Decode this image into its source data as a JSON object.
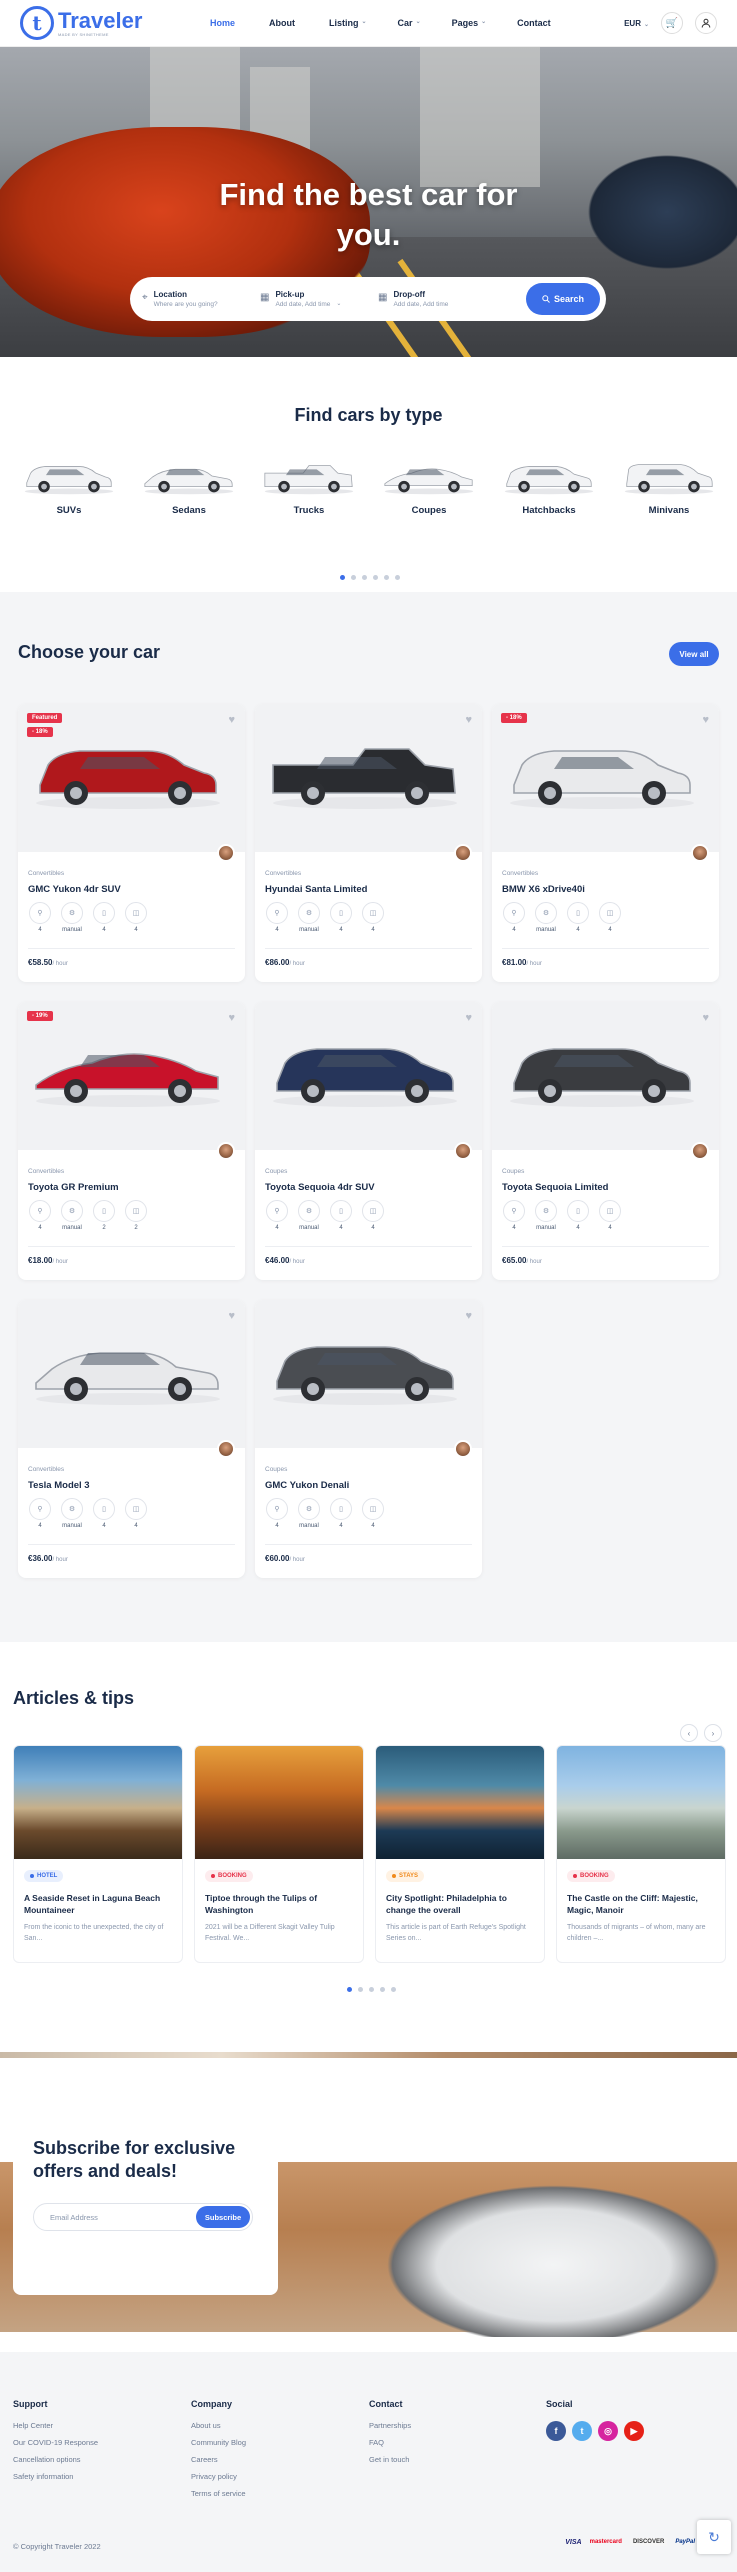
{
  "header": {
    "logo_name": "Traveler",
    "logo_tagline": "MADE BY SHINETHEME",
    "logo_letter": "t",
    "nav": [
      {
        "label": "Home",
        "active": true,
        "dropdown": false
      },
      {
        "label": "About",
        "active": false,
        "dropdown": false
      },
      {
        "label": "Listing",
        "active": false,
        "dropdown": true
      },
      {
        "label": "Car",
        "active": false,
        "dropdown": true
      },
      {
        "label": "Pages",
        "active": false,
        "dropdown": true
      },
      {
        "label": "Contact",
        "active": false,
        "dropdown": false
      }
    ],
    "currency": "EUR",
    "cart_icon": "cart-icon",
    "user_icon": "user-icon"
  },
  "hero": {
    "title_line1": "Find the best car for",
    "title_line2": "you.",
    "search": {
      "location_label": "Location",
      "location_placeholder": "Where are you going?",
      "pickup_label": "Pick-up",
      "pickup_placeholder": "Add date, Add time",
      "dropoff_label": "Drop-off",
      "dropoff_placeholder": "Add date, Add time",
      "button": "Search"
    }
  },
  "types": {
    "title": "Find cars by type",
    "items": [
      "SUVs",
      "Sedans",
      "Trucks",
      "Coupes",
      "Hatchbacks",
      "Minivans"
    ],
    "active_dot": 0,
    "dot_count": 6
  },
  "choose": {
    "title": "Choose your car",
    "view_all": "View all",
    "price_unit": "/ hour",
    "cars": [
      {
        "name": "GMC Yukon 4dr SUV",
        "category": "Convertibles",
        "price": "€58.50",
        "badges": [
          "Featured",
          "- 18%"
        ],
        "specs": [
          "4",
          "manual",
          "4",
          "4"
        ],
        "color": "#b0181c"
      },
      {
        "name": "Hyundai Santa Limited",
        "category": "Convertibles",
        "price": "€86.00",
        "badges": [],
        "specs": [
          "4",
          "manual",
          "4",
          "4"
        ],
        "color": "#2a2c30"
      },
      {
        "name": "BMW X6 xDrive40i",
        "category": "Convertibles",
        "price": "€81.00",
        "badges": [
          "- 18%"
        ],
        "specs": [
          "4",
          "manual",
          "4",
          "4"
        ],
        "color": "#e9eaec"
      },
      {
        "name": "Toyota GR Premium",
        "category": "Convertibles",
        "price": "€18.00",
        "badges": [
          "- 19%"
        ],
        "specs": [
          "4",
          "manual",
          "2",
          "2"
        ],
        "color": "#c8122a"
      },
      {
        "name": "Toyota Sequoia 4dr SUV",
        "category": "Coupes",
        "price": "€46.00",
        "badges": [],
        "specs": [
          "4",
          "manual",
          "4",
          "4"
        ],
        "color": "#26355a"
      },
      {
        "name": "Toyota Sequoia Limited",
        "category": "Coupes",
        "price": "€65.00",
        "badges": [],
        "specs": [
          "4",
          "manual",
          "4",
          "4"
        ],
        "color": "#3a3c40"
      },
      {
        "name": "Tesla Model 3",
        "category": "Convertibles",
        "price": "€36.00",
        "badges": [],
        "specs": [
          "4",
          "manual",
          "4",
          "4"
        ],
        "color": "#e8e9eb"
      },
      {
        "name": "GMC Yukon Denali",
        "category": "Coupes",
        "price": "€60.00",
        "badges": [],
        "specs": [
          "4",
          "manual",
          "4",
          "4"
        ],
        "color": "#4a4d52"
      }
    ]
  },
  "articles": {
    "title": "Articles & tips",
    "items": [
      {
        "tag": "HOTEL",
        "tag_color": "#3b6ee8",
        "tag_bg": "#e8effd",
        "title": "A Seaside Reset in Laguna Beach Mountaineer",
        "excerpt": "From the iconic to the unexpected, the city of San...",
        "img": "linear-gradient(180deg,#3f7fb8 0%,#7fb0d6 30%,#c7b08a 55%,#6b4a2c 75%,#3a2a1a 100%)"
      },
      {
        "tag": "BOOKING",
        "tag_color": "#e6334a",
        "tag_bg": "#fdecee",
        "title": "Tiptoe through the Tulips of Washington",
        "excerpt": "2021 will be a Different Skagit Valley Tulip Festival. We...",
        "img": "linear-gradient(180deg,#e7a03c 0%,#c56a22 40%,#7a3e1a 70%,#3b2416 100%)"
      },
      {
        "tag": "STAYS",
        "tag_color": "#f08a1c",
        "tag_bg": "#fff2e3",
        "title": "City Spotlight: Philadelphia to change the overall",
        "excerpt": "This article is part of Earth Refuge's Spotlight Series on...",
        "img": "linear-gradient(180deg,#2b5c7a 0%,#4f8aa8 35%,#d9874a 55%,#1d3a55 75%,#0f2233 100%)"
      },
      {
        "tag": "BOOKING",
        "tag_color": "#e6334a",
        "tag_bg": "#fdecee",
        "title": "The Castle on the Cliff: Majestic, Magic, Manoir",
        "excerpt": "Thousands of migrants – of whom, many are children –...",
        "img": "linear-gradient(180deg,#7fb3e0 0%,#a9cdeb 35%,#c9d5cf 55%,#8a9a8c 75%,#5e6b64 100%)"
      }
    ],
    "active_dot": 0,
    "dot_count": 5
  },
  "subscribe": {
    "title": "Subscribe for exclusive offers and deals!",
    "placeholder": "Email Address",
    "button": "Subscribe"
  },
  "footer": {
    "columns": [
      {
        "head": "Support",
        "links": [
          "Help Center",
          "Our COVID-19 Response",
          "Cancellation options",
          "Safety information"
        ]
      },
      {
        "head": "Company",
        "links": [
          "About us",
          "Community Blog",
          "Careers",
          "Privacy policy",
          "Terms of service"
        ]
      },
      {
        "head": "Contact",
        "links": [
          "Partnerships",
          "FAQ",
          "Get in touch"
        ]
      }
    ],
    "social_head": "Social",
    "socials": [
      {
        "icon": "facebook-icon",
        "glyph": "f",
        "color": "#3b5998"
      },
      {
        "icon": "twitter-icon",
        "glyph": "t",
        "color": "#55acee"
      },
      {
        "icon": "instagram-icon",
        "glyph": "◎",
        "color": "#d6249f"
      },
      {
        "icon": "youtube-icon",
        "glyph": "▶",
        "color": "#e62117"
      }
    ],
    "copyright": "© Copyright Traveler 2022",
    "payments": [
      "VISA",
      "mastercard",
      "DISCOVER",
      "PayPal"
    ]
  }
}
